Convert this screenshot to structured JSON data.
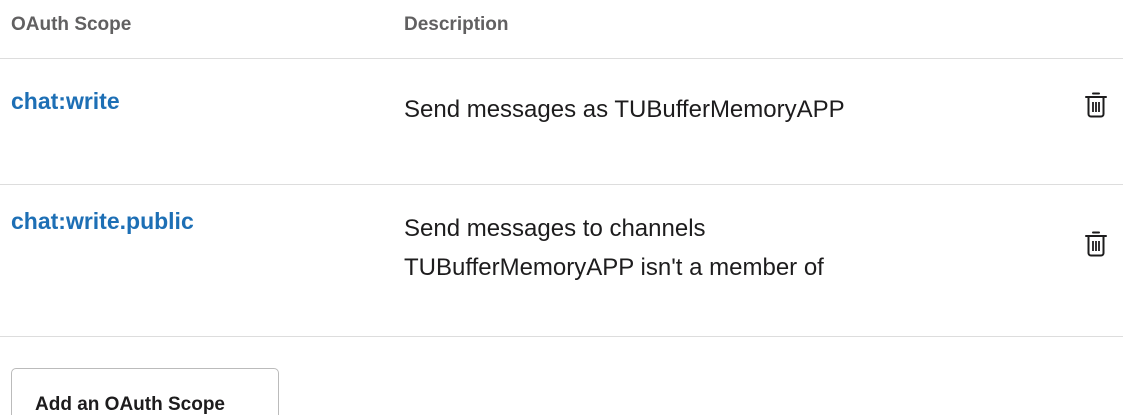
{
  "table": {
    "headers": {
      "scope": "OAuth Scope",
      "description": "Description"
    },
    "rows": [
      {
        "scope": "chat:write",
        "description_lines": [
          "Send messages as TUBufferMemoryAPP"
        ],
        "action_icon": "trash-icon"
      },
      {
        "scope": "chat:write.public",
        "description_lines": [
          "Send messages to channels",
          "TUBufferMemoryAPP isn't a member of"
        ],
        "action_icon": "trash-icon"
      }
    ]
  },
  "add_button": {
    "label": "Add an OAuth Scope"
  },
  "colors": {
    "link": "#1d6fb5",
    "header_text": "#616061",
    "body_text": "#1d1c1d",
    "divider": "#dddddd"
  }
}
